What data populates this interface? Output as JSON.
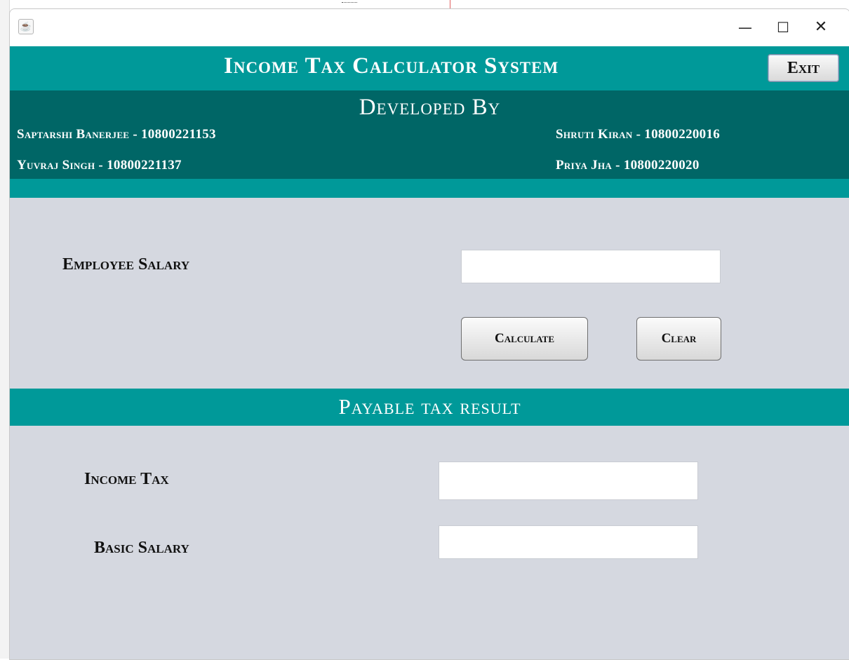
{
  "window": {
    "controls": {
      "minimize": "—",
      "maximize": "☐",
      "close": "✕"
    }
  },
  "header": {
    "title": "Income Tax Calculator System",
    "exit_label": "Exit"
  },
  "developers": {
    "title": "Developed By",
    "names": [
      "Saptarshi Banerjee - 10800221153",
      "Shruti Kiran - 10800220016",
      "Yuvraj Singh - 10800221137",
      "Priya Jha - 10800220020"
    ]
  },
  "form": {
    "salary_label": "Employee Salary",
    "salary_value": "",
    "calculate_label": "Calculate",
    "clear_label": "Clear"
  },
  "result": {
    "title": "Payable tax result",
    "income_tax_label": "Income Tax",
    "income_tax_value": "",
    "basic_salary_label": "Basic Salary",
    "basic_salary_value": ""
  },
  "colors": {
    "teal": "#009999",
    "dark_teal": "#006666",
    "panel": "#d5d8e0"
  },
  "icons": {
    "app_icon": "java-cup-icon"
  }
}
